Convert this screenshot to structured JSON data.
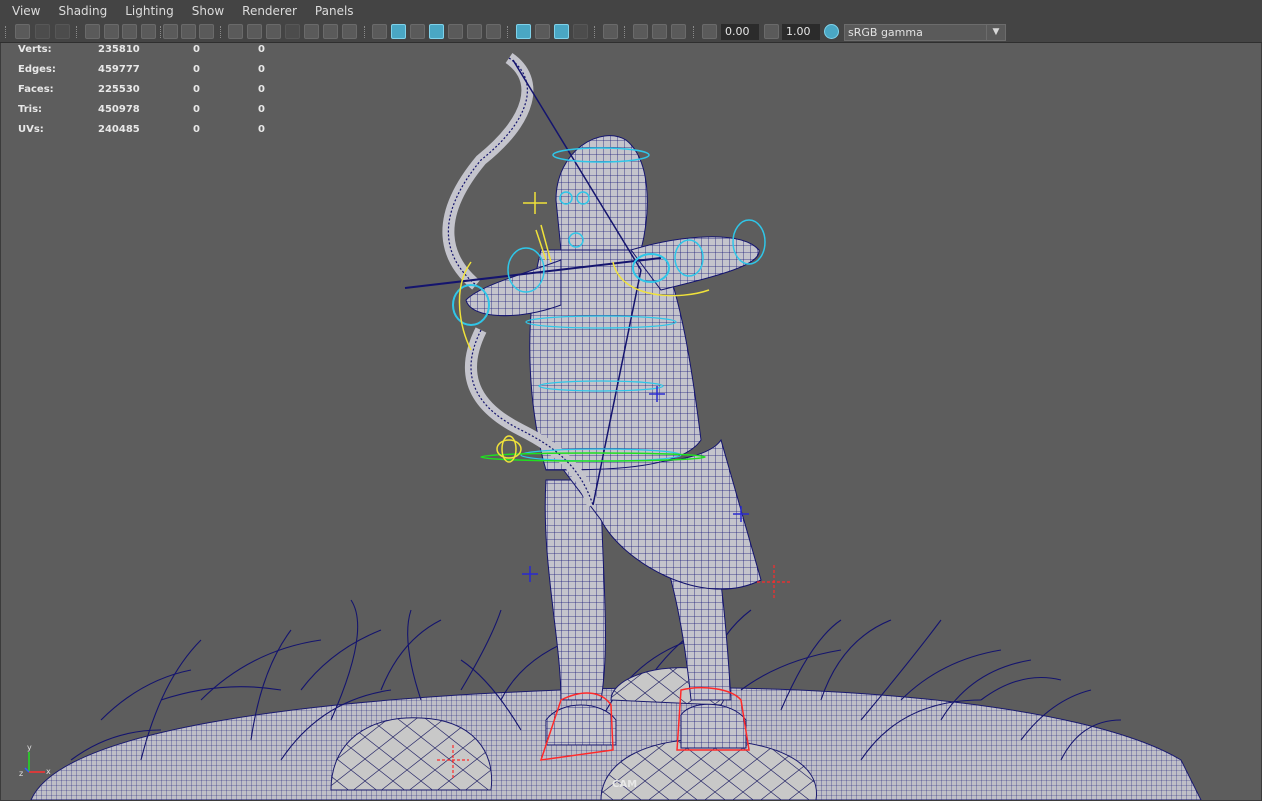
{
  "menu": [
    "View",
    "Shading",
    "Lighting",
    "Show",
    "Renderer",
    "Panels"
  ],
  "toolbar": {
    "exposure_value": "0.00",
    "gamma_value": "1.00",
    "color_space": "sRGB gamma",
    "icons": [
      "select-camera-icon",
      "camera-attributes-icon",
      "bookmarks-icon",
      "image-plane-icon",
      "2d-pan-zoom-icon",
      "grease-pencil-icon",
      "grid-icon",
      "film-gate-icon",
      "resolution-gate-icon",
      "gate-mask-icon",
      "field-chart-icon",
      "safe-action-icon",
      "safe-title-icon",
      "wireframe-icon",
      "smooth-shade-icon",
      "default-material-icon",
      "wireframe-on-shaded-icon",
      "textured-icon",
      "use-all-lights-icon",
      "shadows-icon",
      "screen-space-ao-icon",
      "motion-blur-icon",
      "multisample-aa-icon",
      "depth-of-field-icon",
      "isolate-select-icon",
      "xray-icon",
      "xray-active-components-icon",
      "xray-joints-icon",
      "exposure-icon",
      "gamma-icon",
      "color-management-icon"
    ]
  },
  "hud": [
    {
      "label": "Verts:",
      "v1": "235810",
      "v2": "0",
      "v3": "0"
    },
    {
      "label": "Edges:",
      "v1": "459777",
      "v2": "0",
      "v3": "0"
    },
    {
      "label": "Faces:",
      "v1": "225530",
      "v2": "0",
      "v3": "0"
    },
    {
      "label": "Tris:",
      "v1": "450978",
      "v2": "0",
      "v3": "0"
    },
    {
      "label": "UVs:",
      "v1": "240485",
      "v2": "0",
      "v3": "0"
    }
  ],
  "camera_label": "CAM",
  "axis_labels": {
    "x": "x",
    "y": "y",
    "z": "z"
  },
  "colors": {
    "viewport_bg": "#5d5d5d",
    "wireframe": "#14146e",
    "mesh_fill": "#c4c4cc",
    "control_cyan": "#2fc6e8",
    "control_yellow": "#f0e23a",
    "control_green": "#20e020",
    "control_red": "#ff2a2a",
    "active_button": "#4aa7c4"
  }
}
